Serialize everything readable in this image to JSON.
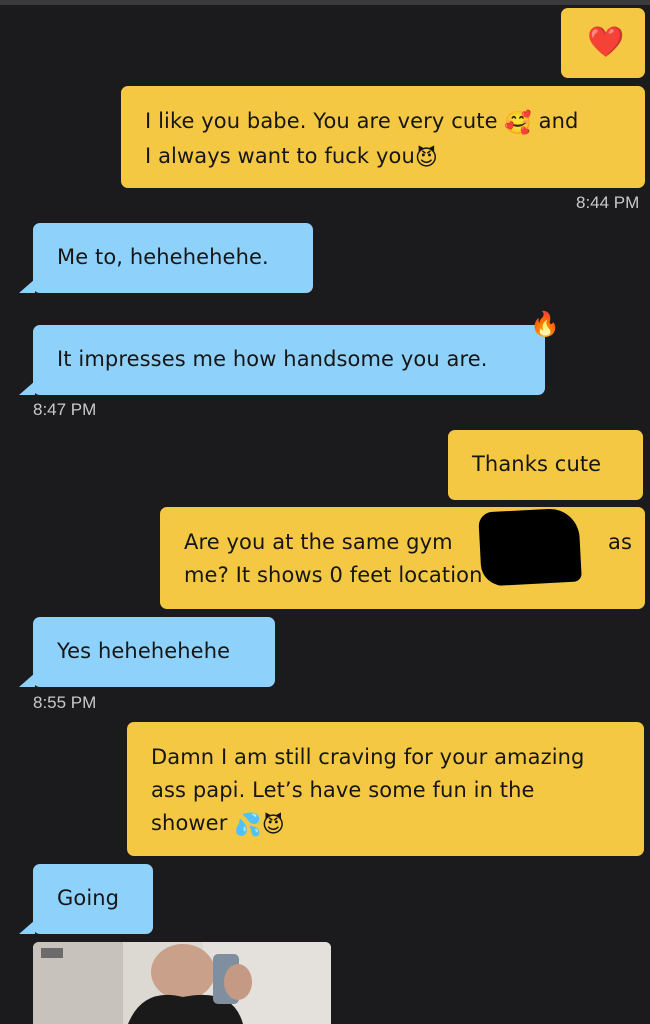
{
  "messages": [
    {
      "side": "out",
      "text": "❤️",
      "icon": "heart"
    },
    {
      "side": "out",
      "text_a": "I like you babe. You are very cute",
      "emoji_a": "🥰",
      "text_b": "and",
      "text_c": "I always want to fuck you",
      "emoji_c": "😈"
    },
    {
      "side": "in",
      "text": "Me to, hehehehehe."
    },
    {
      "side": "in",
      "text": "It impresses me how handsome you are.",
      "reaction": "🔥"
    },
    {
      "side": "out",
      "text": "Thanks cute"
    },
    {
      "side": "out",
      "line1_a": "Are you at the same gym",
      "line1_b": "as",
      "line2": "me? It shows 0 feet location",
      "emoji": "😅"
    },
    {
      "side": "in",
      "text": "Yes hehehehehe"
    },
    {
      "side": "out",
      "line1": "Damn I am still craving for your amazing",
      "line2": "ass papi. Let’s have some fun in the",
      "line3": "shower",
      "emoji1": "💦",
      "emoji2": "😈"
    },
    {
      "side": "in",
      "text": "Going"
    }
  ],
  "timestamps": [
    "8:44 PM",
    "8:47 PM",
    "8:55 PM"
  ],
  "colors": {
    "outgoing": "#f5c843",
    "incoming": "#8ed1fb",
    "background": "#1b1b1d"
  }
}
